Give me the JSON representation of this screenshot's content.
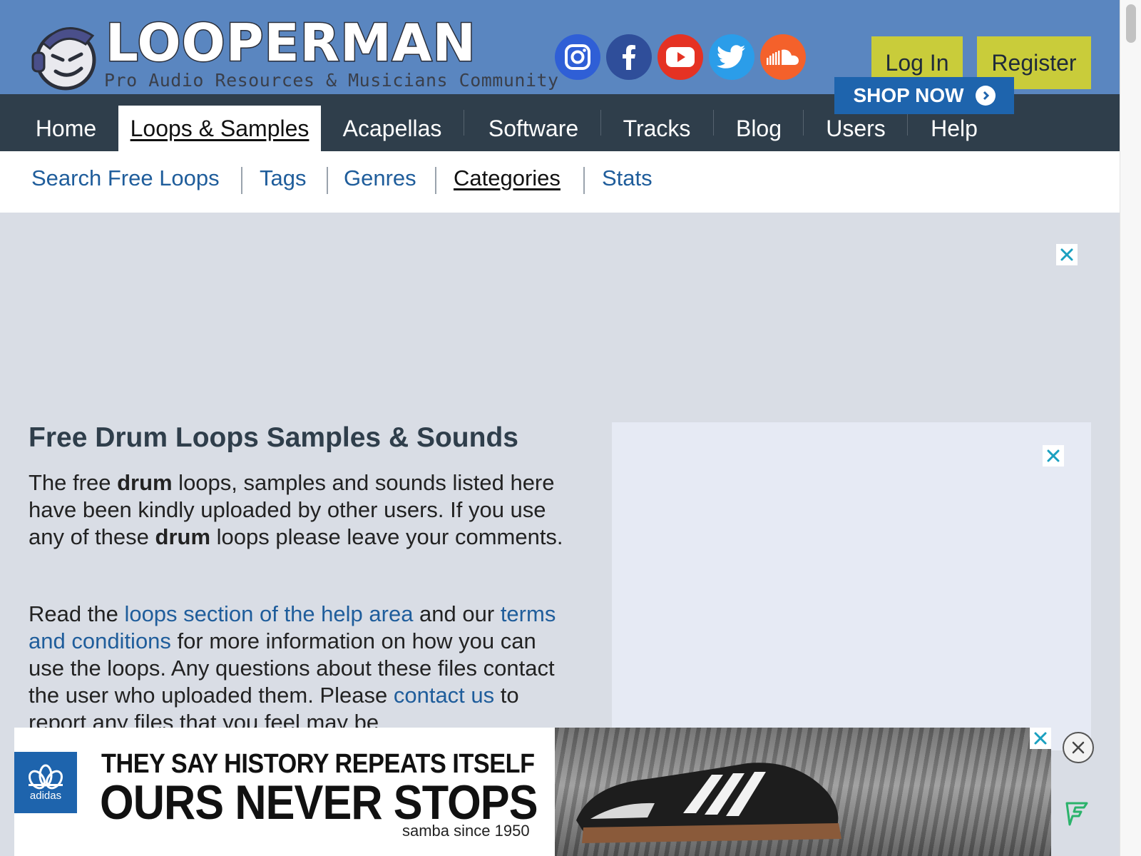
{
  "header": {
    "logo_word": "LOOPERMAN",
    "logo_tagline": "Pro Audio Resources & Musicians Community",
    "social": [
      {
        "icon": "instagram-icon",
        "color": "#2f5fd6"
      },
      {
        "icon": "facebook-icon",
        "color": "#2f4e9a"
      },
      {
        "icon": "youtube-icon",
        "color": "#e53223"
      },
      {
        "icon": "twitter-icon",
        "color": "#2b9de9"
      },
      {
        "icon": "soundcloud-icon",
        "color": "#f4612b"
      }
    ],
    "login_label": "Log In",
    "register_label": "Register"
  },
  "mainnav": {
    "items": [
      "Home",
      "Loops & Samples",
      "Acapellas",
      "Software",
      "Tracks",
      "Blog",
      "Users",
      "Help"
    ],
    "active_index": 1
  },
  "subnav": {
    "items": [
      "Search Free Loops",
      "Tags",
      "Genres",
      "Categories",
      "Stats"
    ],
    "active_index": 3
  },
  "content": {
    "title": "Free Drum Loops Samples & Sounds",
    "p1": {
      "t1": "The free ",
      "b1": "drum",
      "t2": " loops, samples and sounds listed here have been kindly uploaded by other users. If you use any of these ",
      "b2": "drum",
      "t3": " loops please leave your comments."
    },
    "p2": {
      "t1": "Read the ",
      "link1": "loops section of the help area",
      "t2": " and our ",
      "link2": "terms and conditions",
      "t3": " for more information on how you can use the loops. Any questions about these files contact the user who uploaded them. Please ",
      "link3": "contact us",
      "t4": " to report any files that you feel may be"
    }
  },
  "banner": {
    "brand": "adidas",
    "line1": "THEY SAY HISTORY REPEATS ITSELF",
    "line2": "OURS NEVER STOPS",
    "line3": "samba since 1950",
    "cta": "SHOP NOW"
  },
  "colors": {
    "header_bg": "#5a86c0",
    "nav_bg": "#2f3e4b",
    "accent_button": "#c9cc3a",
    "link": "#1f5d9b"
  }
}
